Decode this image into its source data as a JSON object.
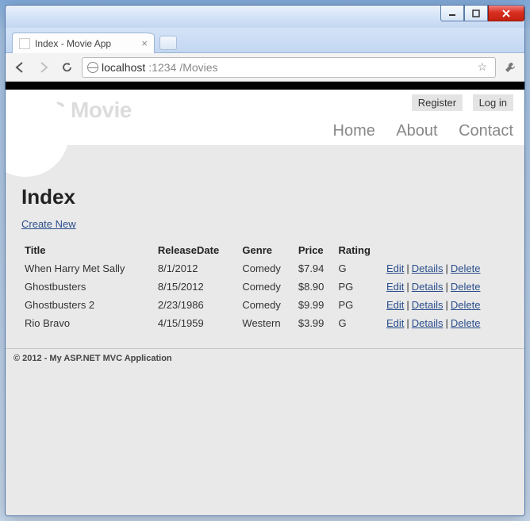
{
  "browser": {
    "tab_title": "Index - Movie App",
    "url_host": "localhost",
    "url_port": ":1234",
    "url_path": "/Movies"
  },
  "header": {
    "brand": "MVC Movie",
    "register": "Register",
    "login": "Log in",
    "nav": {
      "home": "Home",
      "about": "About",
      "contact": "Contact"
    }
  },
  "page": {
    "title": "Index",
    "create_new": "Create New",
    "columns": {
      "title": "Title",
      "releaseDate": "ReleaseDate",
      "genre": "Genre",
      "price": "Price",
      "rating": "Rating"
    },
    "actions": {
      "edit": "Edit",
      "details": "Details",
      "delete": "Delete"
    },
    "rows": [
      {
        "title": "When Harry Met Sally",
        "releaseDate": "8/1/2012",
        "genre": "Comedy",
        "price": "$7.94",
        "rating": "G"
      },
      {
        "title": "Ghostbusters",
        "releaseDate": "8/15/2012",
        "genre": "Comedy",
        "price": "$8.90",
        "rating": "PG"
      },
      {
        "title": "Ghostbusters 2",
        "releaseDate": "2/23/1986",
        "genre": "Comedy",
        "price": "$9.99",
        "rating": "PG"
      },
      {
        "title": "Rio Bravo",
        "releaseDate": "4/15/1959",
        "genre": "Western",
        "price": "$3.99",
        "rating": "G"
      }
    ]
  },
  "footer": "© 2012 - My ASP.NET MVC Application"
}
